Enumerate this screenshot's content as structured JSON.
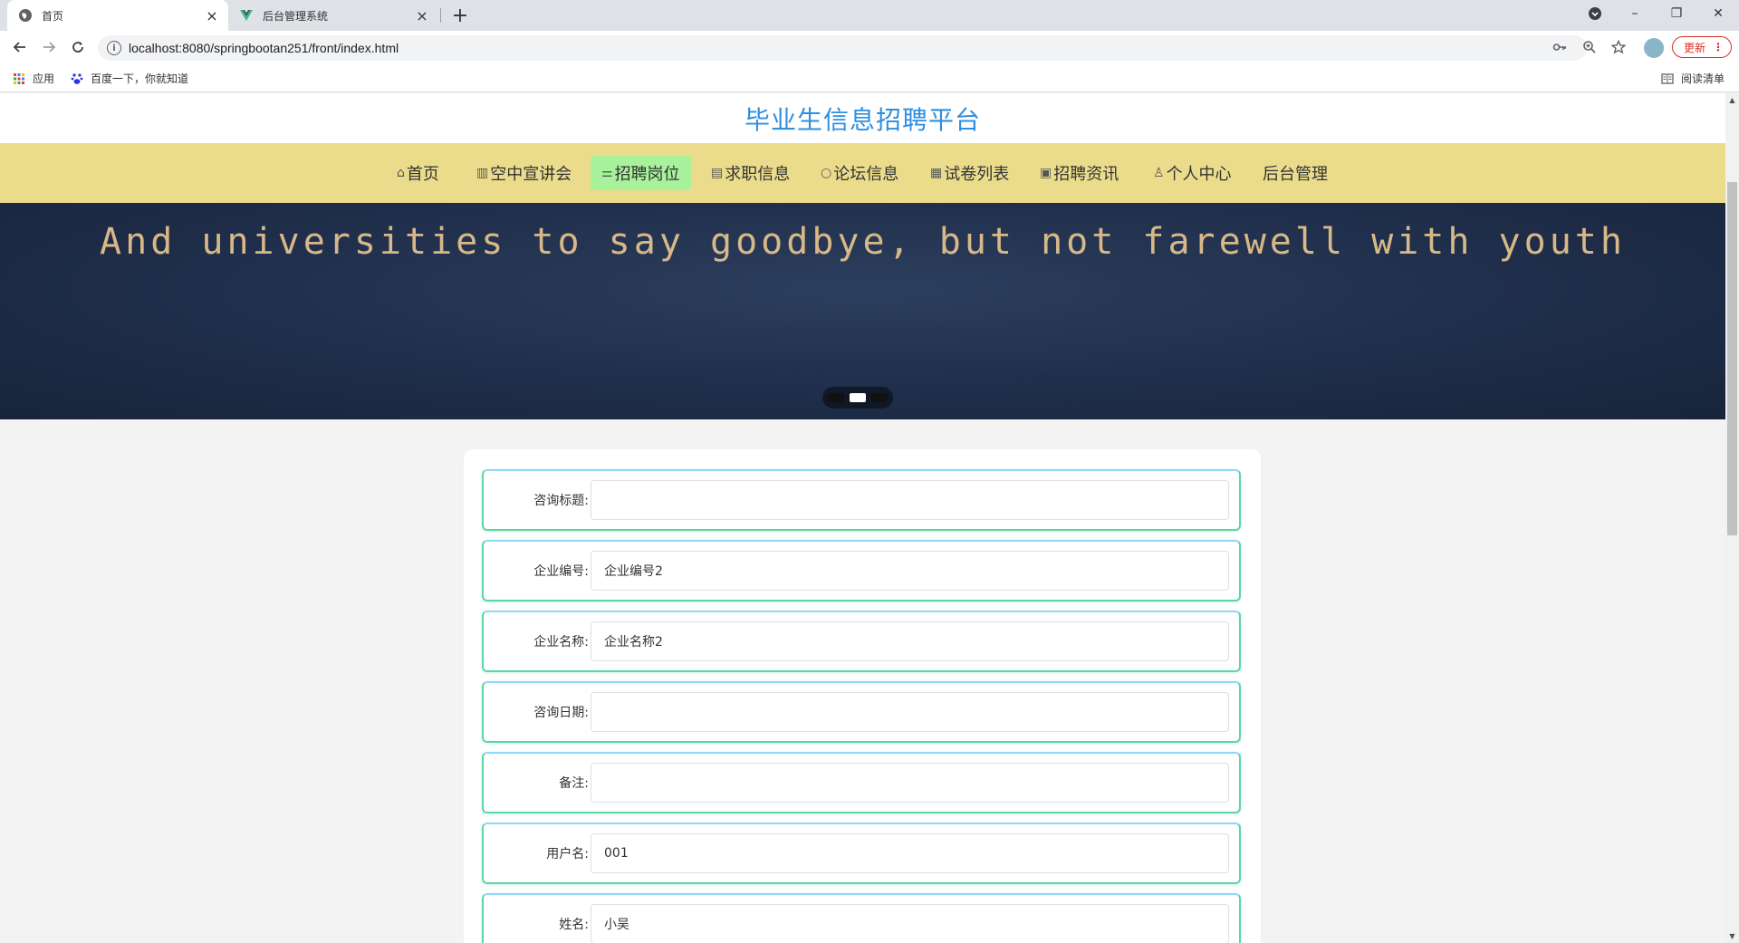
{
  "browser": {
    "tabs": [
      {
        "title": "首页",
        "close": "×"
      },
      {
        "title": "后台管理系统",
        "close": "×"
      }
    ],
    "new_tab": "+",
    "window_controls": {
      "minimize": "–",
      "restore": "❐",
      "close": "✕"
    },
    "url": "localhost:8080/springbootan251/front/index.html",
    "update_label": "更新",
    "update_menu": "⋮",
    "bookmarks": [
      {
        "label": "应用",
        "icon": "apps-grid-icon"
      },
      {
        "label": "百度一下，你就知道",
        "icon": "baidu-paw-icon"
      }
    ],
    "reading_list": "阅读清单"
  },
  "site": {
    "title": "毕业生信息招聘平台",
    "nav": [
      {
        "glyph": "⌂",
        "label": "首页"
      },
      {
        "glyph": "▥",
        "label": "空中宣讲会"
      },
      {
        "glyph": "⚌",
        "label": "招聘岗位"
      },
      {
        "glyph": "▤",
        "label": "求职信息"
      },
      {
        "glyph": "○",
        "label": "论坛信息"
      },
      {
        "glyph": "▦",
        "label": "试卷列表"
      },
      {
        "glyph": "▣",
        "label": "招聘资讯"
      },
      {
        "glyph": "♙",
        "label": "个人中心"
      },
      {
        "glyph": "",
        "label": "后台管理"
      }
    ],
    "active_nav": "招聘岗位",
    "banner": {
      "text": "And universities to say goodbye, but not farewell with youth",
      "slides": 3,
      "active_slide": 2
    }
  },
  "form": {
    "fields": [
      {
        "label": "咨询标题:",
        "value": ""
      },
      {
        "label": "企业编号:",
        "value": "企业编号2"
      },
      {
        "label": "企业名称:",
        "value": "企业名称2"
      },
      {
        "label": "咨询日期:",
        "value": ""
      },
      {
        "label": "备注:",
        "value": ""
      },
      {
        "label": "用户名:",
        "value": "001"
      },
      {
        "label": "姓名:",
        "value": "小吴"
      }
    ]
  },
  "colors": {
    "site_title": "#2c8fe0",
    "nav_bg": "#ebdc8c",
    "nav_active": "#a7f29a",
    "banner_bg": "#1f2e4a",
    "banner_text": "#d8b889",
    "row_border": "#5ad7a4"
  }
}
